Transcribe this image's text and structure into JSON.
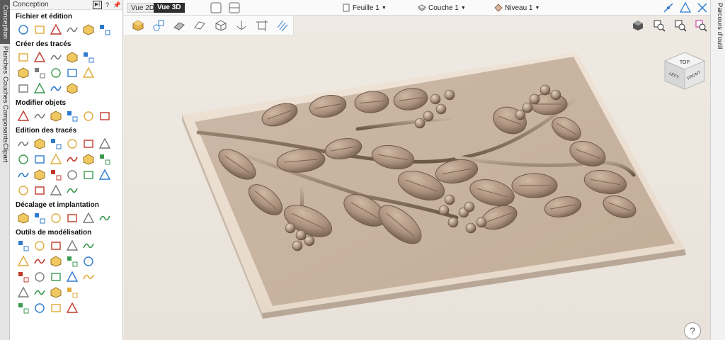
{
  "vtabs": [
    "Conception",
    "Planches",
    "Couches",
    "Composants",
    "Clipart"
  ],
  "panel": {
    "title": "Conception",
    "help_glyph": "?",
    "sections": [
      {
        "title": "Fichier et édition",
        "rows": [
          [
            "crop-icon",
            "open-file-icon",
            "import-icon",
            "export-icon",
            "settings-gear-icon",
            "layers-icon"
          ]
        ]
      },
      {
        "title": "Créer des tracés",
        "rows": [
          [
            "circle-icon",
            "ellipse-icon",
            "rectangle-icon",
            "polygon-icon",
            "star-icon"
          ],
          [
            "polyline-icon",
            "arc-icon",
            "spiral-icon",
            "pattern-fill-icon",
            "dimension-icon"
          ],
          [
            "text-icon",
            "text-on-curve-icon",
            "text-arc-icon",
            "image-trace-icon"
          ]
        ]
      },
      {
        "title": "Modifier objets",
        "rows": [
          [
            "transform-icon",
            "scale-icon",
            "align-icon",
            "rotate-icon",
            "mirror-icon",
            "group-icon"
          ]
        ]
      },
      {
        "title": "Edition des tracés",
        "rows": [
          [
            "select-icon",
            "node-edit-icon",
            "node-add-icon",
            "node-smooth-icon",
            "node-cut-icon",
            "close-path-icon"
          ],
          [
            "weld-icon",
            "subtract-icon",
            "intersect-icon",
            "offset-icon",
            "trim-icon",
            "check-icon"
          ],
          [
            "fillet-icon",
            "curve-icon",
            "wave-icon",
            "join-icon",
            "import-vector-icon",
            "validate-icon"
          ],
          [
            "rounded-rect-icon",
            "slot-icon",
            "chamfer-icon",
            "arrow-icon"
          ]
        ]
      },
      {
        "title": "Décalage et implantation",
        "rows": [
          [
            "offset-shape-icon",
            "nest-icon",
            "array-icon",
            "copy-along-icon",
            "qr-icon",
            "layout-icon"
          ]
        ]
      },
      {
        "title": "Outils de modélisation",
        "rows": [
          [
            "component-icon",
            "sphere-icon",
            "dome-icon",
            "extrude-icon",
            "pyramid-icon"
          ],
          [
            "cylinder-icon",
            "twist-icon",
            "mold-icon",
            "stamp-icon",
            "ribbon-icon"
          ],
          [
            "texture-icon",
            "chain-icon",
            "sculpt-icon",
            "smooth-icon",
            "fill-icon"
          ],
          [
            "cube-icon",
            "merge-icon",
            "cut-icon",
            "bevel-icon"
          ],
          [
            "plate-icon",
            "fold-icon",
            "box-icon",
            "block-icon"
          ]
        ]
      }
    ]
  },
  "topbar": {
    "btn_2d": "Vue 2D",
    "btn_3d": "Vue 3D",
    "sheet": "Feuille 1",
    "layer": "Couche 1",
    "level": "Niveau 1"
  },
  "rtab": "Parcours d'outil",
  "viewcube": {
    "top": "TOP",
    "left": "LEFT",
    "front": "FRONT"
  },
  "help": "?",
  "colors": {
    "wood": "#b89e8b",
    "wood_dark": "#7c6657",
    "plate_top": "#d8c7b6",
    "accent": "#2d2d2d"
  }
}
